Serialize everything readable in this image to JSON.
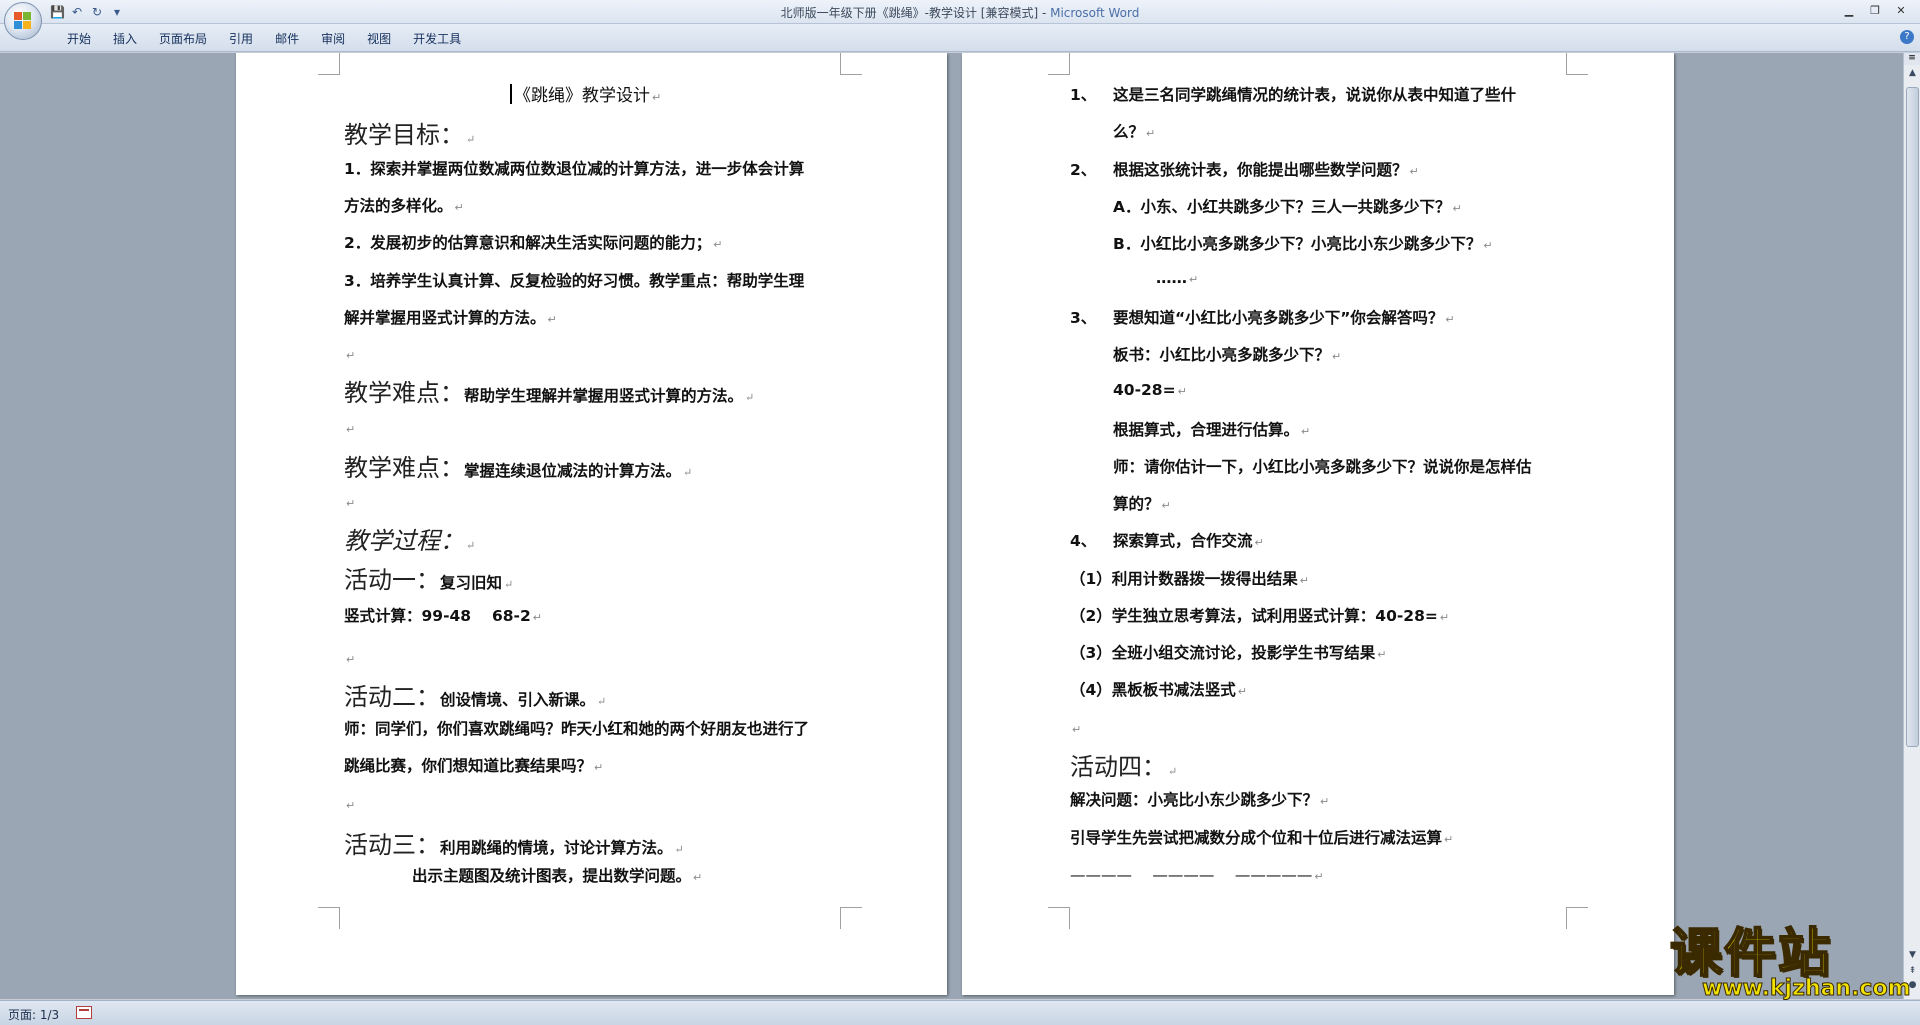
{
  "window": {
    "title_doc": "北师版一年级下册《跳绳》-教学设计 [兼容模式] - ",
    "title_app": "Microsoft Word"
  },
  "quick_access": {
    "save": "💾",
    "undo": "↶",
    "redo": "↻",
    "more": "▾"
  },
  "ribbon": {
    "tabs": [
      "开始",
      "插入",
      "页面布局",
      "引用",
      "邮件",
      "审阅",
      "视图",
      "开发工具"
    ]
  },
  "page1": {
    "title": "《跳绳》教学设计",
    "goal_heading": "教学目标：",
    "goal_1a": "1．探索并掌握两位数减两位数退位减的计算方法，进一步体会计算",
    "goal_1b": "方法的多样化。",
    "goal_2": "2．发展初步的估算意识和解决生活实际问题的能力；",
    "goal_3a": "3．培养学生认真计算、反复检验的好习惯。教学重点：帮助学生理",
    "goal_3b": "解并掌握用竖式计算的方法。",
    "diff1_heading": "教学难点：",
    "diff1_text": "帮助学生理解并掌握用竖式计算的方法。",
    "diff2_heading": "教学难点：",
    "diff2_text": "掌握连续退位减法的计算方法。",
    "process_heading": "教学过程：",
    "act1_heading": "活动一：",
    "act1_text": "复习旧知",
    "act1_calc": "竖式计算：99-48　 68-2",
    "act2_heading": "活动二：",
    "act2_text": "创设情境、引入新课。",
    "act2_p1": "师：同学们，你们喜欢跳绳吗？昨天小红和她的两个好朋友也进行了",
    "act2_p2": "跳绳比赛，你们想知道比赛结果吗？",
    "act3_heading": "活动三：",
    "act3_text": "利用跳绳的情境，讨论计算方法。",
    "act3_sub": "出示主题图及统计图表，提出数学问题。"
  },
  "page2": {
    "q1_num": "1、",
    "q1a": "这是三名同学跳绳情况的统计表，说说你从表中知道了些什",
    "q1b": "么？",
    "q2_num": "2、",
    "q2": "根据这张统计表，你能提出哪些数学问题？",
    "q2_a": "A．小东、小红共跳多少下？三人一共跳多少下？",
    "q2_b": "B．小红比小亮多跳多少下？小亮比小东少跳多少下？",
    "q2_dots": "……",
    "q3_num": "3、",
    "q3": "要想知道“小红比小亮多跳多少下”你会解答吗？",
    "q3_board": "板书：小红比小亮多跳多少下？",
    "q3_eq": "40-28=",
    "q3_est": "根据算式，合理进行估算。",
    "q3_teacher_a": "师：请你估计一下，小红比小亮多跳多少下？说说你是怎样估",
    "q3_teacher_b": "算的？",
    "q4_num": "4、",
    "q4": "探索算式，合作交流",
    "s1": "（1）利用计数器拨一拨得出结果",
    "s2": "（2）学生独立思考算法，试利用竖式计算：40-28=",
    "s3": "（3）全班小组交流讨论，投影学生书写结果",
    "s4": "（4）黑板板书减法竖式",
    "act4_heading": "活动四：",
    "act4_p1": "解决问题：小亮比小东少跳多少下？",
    "act4_p2": "引导学生先尝试把减数分成个位和十位后进行减法运算",
    "act4_blanks": "————　 ————　 —————"
  },
  "para_mark": "↵",
  "statusbar": {
    "page": "页面: 1/3"
  },
  "watermark": {
    "logo": "课件站",
    "url": "www.kjzhan.com"
  },
  "colors": {
    "doc_bg": "#9ba6b4",
    "ribbon": "#dbe4f0",
    "watermark_yellow": "#f2e200"
  }
}
